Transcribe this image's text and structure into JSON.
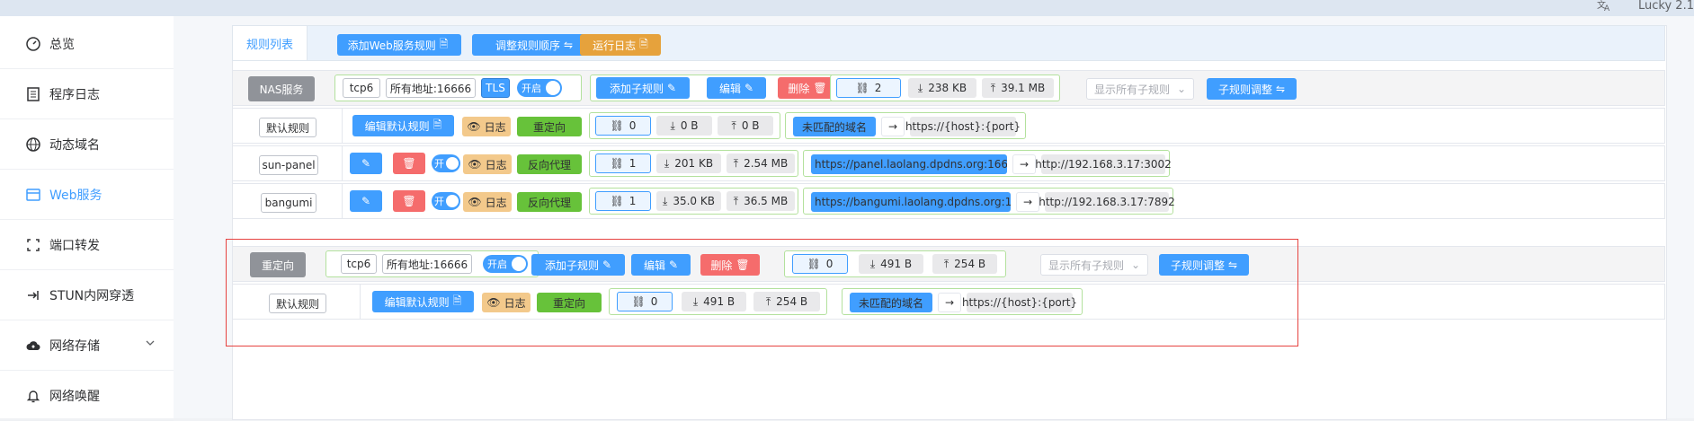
{
  "topbar": {
    "app_version": "Lucky 2.1"
  },
  "sidebar": {
    "items": [
      {
        "label": "总览",
        "icon": "dashboard-icon"
      },
      {
        "label": "程序日志",
        "icon": "log-icon"
      },
      {
        "label": "动态域名",
        "icon": "ddns-icon"
      },
      {
        "label": "Web服务",
        "icon": "web-icon"
      },
      {
        "label": "端口转发",
        "icon": "port-forward-icon"
      },
      {
        "label": "STUN内网穿透",
        "icon": "stun-icon"
      },
      {
        "label": "网络存储",
        "icon": "cloud-storage-icon"
      },
      {
        "label": "网络唤醒",
        "icon": "bell-icon"
      }
    ]
  },
  "tabs": {
    "rule_list": "规则列表"
  },
  "toolbar": {
    "add_web_rule": "添加Web服务规则",
    "adjust_order": "调整规则顺序",
    "run_log": "运行日志"
  },
  "colors": {
    "accent": "#409eff",
    "success": "#67c23a",
    "warning": "#e6a23c",
    "danger": "#f56c6c",
    "highlight_box": "#e64340"
  },
  "rules": [
    {
      "name": "NAS服务",
      "protocol": "tcp6",
      "address": "所有地址:16666",
      "tls": "TLS",
      "switch": "开启",
      "add_sub": "添加子规则",
      "edit": "编辑",
      "delete": "删除",
      "conn": "2",
      "down": "238 KB",
      "up": "39.1 MB",
      "filter_placeholder": "显示所有子规则",
      "sub_adjust": "子规则调整",
      "subrules": [
        {
          "label": "默认规则",
          "edit_default": "编辑默认规则",
          "log": "日志",
          "mode": "重定向",
          "conn": "0",
          "down": "0 B",
          "up": "0 B",
          "match": "未匹配的域名",
          "target": "https://{host}:{port}"
        },
        {
          "label": "sun-panel",
          "switch": "开",
          "log": "日志",
          "mode": "反向代理",
          "conn": "1",
          "down": "201 KB",
          "up": "2.54 MB",
          "match": "https://panel.laolang.dpdns.org:1666...",
          "target": "http://192.168.3.17:3002"
        },
        {
          "label": "bangumi",
          "switch": "开",
          "log": "日志",
          "mode": "反向代理",
          "conn": "1",
          "down": "35.0 KB",
          "up": "36.5 MB",
          "match": "https://bangumi.laolang.dpdns.org:16...",
          "target": "http://192.168.3.17:7892"
        }
      ]
    },
    {
      "name": "重定向",
      "protocol": "tcp6",
      "address": "所有地址:16666",
      "switch": "开启",
      "add_sub": "添加子规则",
      "edit": "编辑",
      "delete": "删除",
      "conn": "0",
      "down": "491 B",
      "up": "254 B",
      "filter_placeholder": "显示所有子规则",
      "sub_adjust": "子规则调整",
      "subrules": [
        {
          "label": "默认规则",
          "edit_default": "编辑默认规则",
          "log": "日志",
          "mode": "重定向",
          "conn": "0",
          "down": "491 B",
          "up": "254 B",
          "match": "未匹配的域名",
          "target": "https://{host}:{port}"
        }
      ]
    }
  ],
  "arrow": "→"
}
